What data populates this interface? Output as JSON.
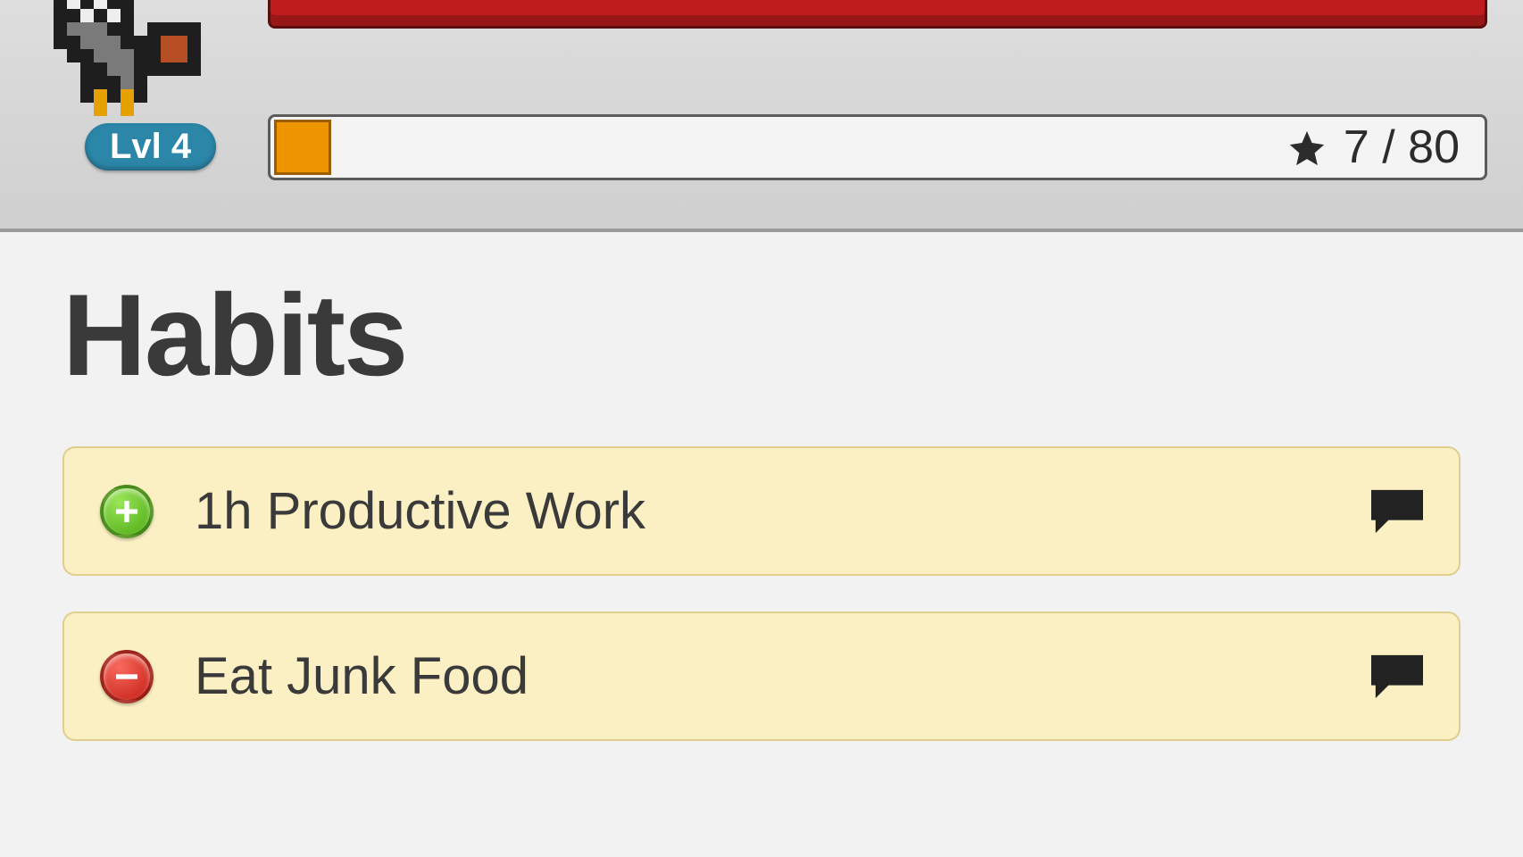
{
  "player": {
    "level_label": "Lvl 4",
    "xp_current": 7,
    "xp_max": 80,
    "xp_text": "★ 7 / 80"
  },
  "section_title": "Habits",
  "habits": [
    {
      "label": "1h Productive Work",
      "type": "plus"
    },
    {
      "label": "Eat Junk Food",
      "type": "minus"
    }
  ]
}
